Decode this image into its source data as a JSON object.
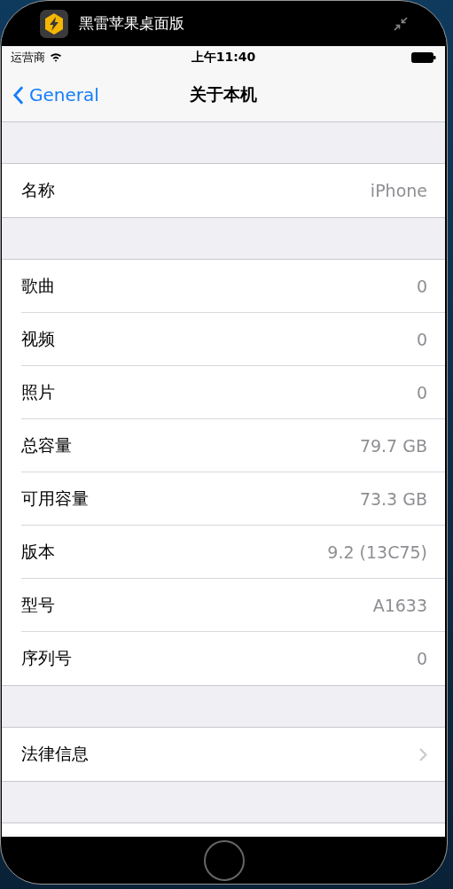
{
  "window": {
    "title": "黑雷苹果桌面版"
  },
  "status_bar": {
    "carrier": "运营商",
    "time": "上午11:40"
  },
  "nav": {
    "back": "General",
    "title": "关于本机"
  },
  "sections": [
    {
      "rows": [
        {
          "kind": "value",
          "label": "名称",
          "value": "iPhone"
        }
      ]
    },
    {
      "rows": [
        {
          "kind": "value",
          "label": "歌曲",
          "value": "0"
        },
        {
          "kind": "value",
          "label": "视频",
          "value": "0"
        },
        {
          "kind": "value",
          "label": "照片",
          "value": "0"
        },
        {
          "kind": "value",
          "label": "总容量",
          "value": "79.7 GB"
        },
        {
          "kind": "value",
          "label": "可用容量",
          "value": "73.3 GB"
        },
        {
          "kind": "value",
          "label": "版本",
          "value": "9.2 (13C75)"
        },
        {
          "kind": "value",
          "label": "型号",
          "value": "A1633"
        },
        {
          "kind": "value",
          "label": "序列号",
          "value": "0"
        }
      ]
    },
    {
      "rows": [
        {
          "kind": "disclosure",
          "label": "法律信息"
        }
      ]
    }
  ]
}
